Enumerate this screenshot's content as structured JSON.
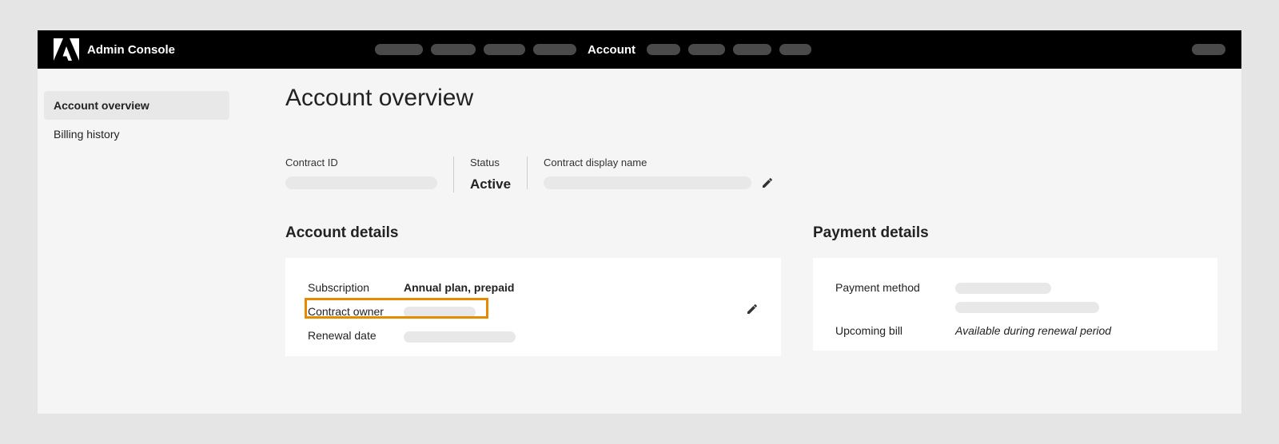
{
  "header": {
    "app_title": "Admin Console",
    "active_nav": "Account"
  },
  "sidebar": {
    "items": [
      {
        "label": "Account overview",
        "active": true
      },
      {
        "label": "Billing history",
        "active": false
      }
    ]
  },
  "main": {
    "page_title": "Account overview",
    "meta": {
      "contract_id_label": "Contract ID",
      "status_label": "Status",
      "status_value": "Active",
      "display_name_label": "Contract display name"
    },
    "account_details": {
      "section_title": "Account details",
      "rows": [
        {
          "label": "Subscription",
          "value": "Annual plan, prepaid"
        },
        {
          "label": "Contract owner",
          "value": ""
        },
        {
          "label": "Renewal date",
          "value": ""
        }
      ]
    },
    "payment_details": {
      "section_title": "Payment details",
      "payment_method_label": "Payment method",
      "upcoming_bill_label": "Upcoming bill",
      "upcoming_bill_value": "Available during renewal period"
    }
  }
}
